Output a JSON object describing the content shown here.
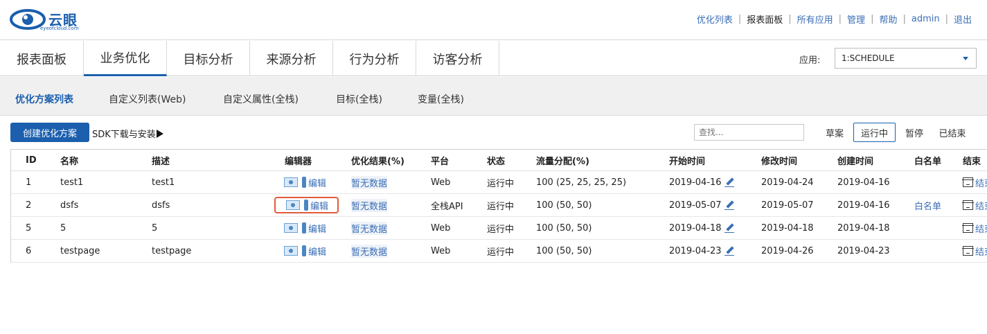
{
  "header": {
    "logo_text": "云眼",
    "logo_sub": "eyeofcloud.com",
    "links": [
      "优化列表",
      "报表面板",
      "所有应用",
      "管理",
      "帮助",
      "admin",
      "退出"
    ]
  },
  "nav": {
    "tabs": [
      "报表面板",
      "业务优化",
      "目标分析",
      "来源分析",
      "行为分析",
      "访客分析"
    ],
    "active": "业务优化",
    "app_label": "应用:",
    "app_value": "1:SCHEDULE"
  },
  "subnav": {
    "tabs": [
      "优化方案列表",
      "自定义列表(Web)",
      "自定义属性(全栈)",
      "目标(全栈)",
      "变量(全栈)"
    ]
  },
  "toolbar": {
    "create_label": "创建优化方案",
    "sdk_label": "SDK下载与安装",
    "search_placeholder": "查找...",
    "filters": [
      "草案",
      "运行中",
      "暂停",
      "已结束"
    ]
  },
  "table": {
    "headers": [
      "ID",
      "名称",
      "描述",
      "编辑器",
      "优化结果(%)",
      "平台",
      "状态",
      "流量分配(%)",
      "开始时间",
      "修改时间",
      "创建时间",
      "白名单",
      "结束"
    ],
    "edit_label": "编辑",
    "end_label": "结束",
    "rows": [
      {
        "id": "1",
        "name": "test1",
        "desc": "test1",
        "result": "暂无数据",
        "platform": "Web",
        "status": "运行中",
        "traffic": "100 (25, 25, 25, 25)",
        "start": "2019-04-16",
        "modified": "2019-04-24",
        "created": "2019-04-16",
        "whitelist": ""
      },
      {
        "id": "2",
        "name": "dsfs",
        "desc": "dsfs",
        "result": "暂无数据",
        "platform": "全栈API",
        "status": "运行中",
        "traffic": "100 (50, 50)",
        "start": "2019-05-07",
        "modified": "2019-05-07",
        "created": "2019-04-16",
        "whitelist": "白名单"
      },
      {
        "id": "5",
        "name": "5",
        "desc": "5",
        "result": "暂无数据",
        "platform": "Web",
        "status": "运行中",
        "traffic": "100 (50, 50)",
        "start": "2019-04-18",
        "modified": "2019-04-18",
        "created": "2019-04-18",
        "whitelist": ""
      },
      {
        "id": "6",
        "name": "testpage",
        "desc": "testpage",
        "result": "暂无数据",
        "platform": "Web",
        "status": "运行中",
        "traffic": "100 (50, 50)",
        "start": "2019-04-23",
        "modified": "2019-04-26",
        "created": "2019-04-23",
        "whitelist": ""
      }
    ]
  },
  "colors": {
    "brand": "#1b5fae",
    "link": "#3a6eb5",
    "highlight": "#e05a3a"
  }
}
